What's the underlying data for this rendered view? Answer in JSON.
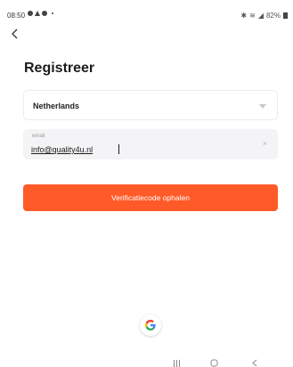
{
  "status_bar": {
    "time": "08:50",
    "battery": "82%"
  },
  "page": {
    "title": "Registreer"
  },
  "country_select": {
    "value": "Netherlands"
  },
  "email_field": {
    "label": "email",
    "value": "info@quality4u.nl",
    "clear_symbol": "×"
  },
  "verify_button": {
    "label": "Verificatiecode ophalen"
  },
  "colors": {
    "accent": "#ff5a28",
    "field_background": "#f4f4f6"
  },
  "icons": {
    "back": "chevron-left-icon",
    "dropdown": "chevron-down-icon",
    "clear": "clear-icon",
    "google": "google-logo-icon"
  }
}
